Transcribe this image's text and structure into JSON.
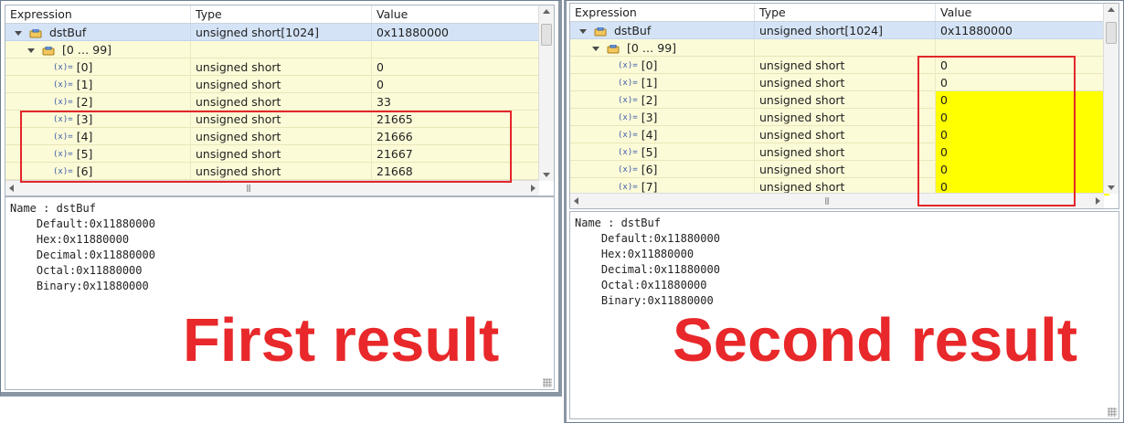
{
  "colors": {
    "accent_red": "#e3262a",
    "row_yellow": "#fcfbd8",
    "highlight": "#ffff00",
    "selected": "#d4e3f6"
  },
  "panels": [
    {
      "columns": [
        "Expression",
        "Type",
        "Value"
      ],
      "root": {
        "expr": "dstBuf",
        "type": "unsigned short[1024]",
        "value": "0x11880000"
      },
      "group": {
        "expr": "[0 … 99]",
        "type": "",
        "value": ""
      },
      "items": [
        {
          "expr": "[0]",
          "type": "unsigned short",
          "value": "0"
        },
        {
          "expr": "[1]",
          "type": "unsigned short",
          "value": "0"
        },
        {
          "expr": "[2]",
          "type": "unsigned short",
          "value": "33"
        },
        {
          "expr": "[3]",
          "type": "unsigned short",
          "value": "21665"
        },
        {
          "expr": "[4]",
          "type": "unsigned short",
          "value": "21666"
        },
        {
          "expr": "[5]",
          "type": "unsigned short",
          "value": "21667"
        },
        {
          "expr": "[6]",
          "type": "unsigned short",
          "value": "21668"
        }
      ],
      "details": "Name : dstBuf\n    Default:0x11880000\n    Hex:0x11880000\n    Decimal:0x11880000\n    Octal:0x11880000\n    Binary:0x11880000",
      "caption": "First result"
    },
    {
      "columns": [
        "Expression",
        "Type",
        "Value"
      ],
      "root": {
        "expr": "dstBuf",
        "type": "unsigned short[1024]",
        "value": "0x11880000"
      },
      "group": {
        "expr": "[0 … 99]",
        "type": "",
        "value": ""
      },
      "items": [
        {
          "expr": "[0]",
          "type": "unsigned short",
          "value": "0",
          "changed": false
        },
        {
          "expr": "[1]",
          "type": "unsigned short",
          "value": "0",
          "changed": false
        },
        {
          "expr": "[2]",
          "type": "unsigned short",
          "value": "0",
          "changed": true
        },
        {
          "expr": "[3]",
          "type": "unsigned short",
          "value": "0",
          "changed": true
        },
        {
          "expr": "[4]",
          "type": "unsigned short",
          "value": "0",
          "changed": true
        },
        {
          "expr": "[5]",
          "type": "unsigned short",
          "value": "0",
          "changed": true
        },
        {
          "expr": "[6]",
          "type": "unsigned short",
          "value": "0",
          "changed": true
        },
        {
          "expr": "[7]",
          "type": "unsigned short",
          "value": "0",
          "changed": true
        }
      ],
      "details": "Name : dstBuf\n    Default:0x11880000\n    Hex:0x11880000\n    Decimal:0x11880000\n    Octal:0x11880000\n    Binary:0x11880000",
      "caption": "Second result"
    }
  ]
}
